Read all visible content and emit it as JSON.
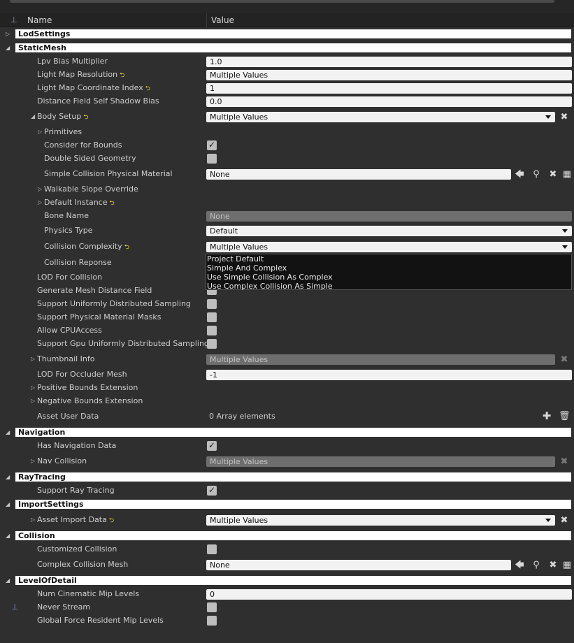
{
  "header": {
    "name_col": "Name",
    "value_col": "Value"
  },
  "categories": {
    "lod_settings": "LodSettings",
    "static_mesh": "StaticMesh",
    "navigation": "Navigation",
    "ray_tracing": "RayTracing",
    "import_settings": "ImportSettings",
    "collision": "Collision",
    "level_of_detail": "LevelOfDetail"
  },
  "static_mesh": {
    "lpv_bias_multiplier": {
      "label": "Lpv Bias Multiplier",
      "value": "1.0"
    },
    "light_map_resolution": {
      "label": "Light Map Resolution",
      "value": "Multiple Values"
    },
    "light_map_coordinate_index": {
      "label": "Light Map Coordinate Index",
      "value": "1"
    },
    "distance_field_self_shadow_bias": {
      "label": "Distance Field Self Shadow Bias",
      "value": "0.0"
    },
    "body_setup": {
      "label": "Body Setup",
      "value": "Multiple Values"
    },
    "primitives": {
      "label": "Primitives"
    },
    "consider_for_bounds": {
      "label": "Consider for Bounds",
      "checked": true
    },
    "double_sided_geometry": {
      "label": "Double Sided Geometry",
      "checked": false
    },
    "simple_collision_physical_material": {
      "label": "Simple Collision Physical Material",
      "value": "None"
    },
    "walkable_slope_override": {
      "label": "Walkable Slope Override"
    },
    "default_instance": {
      "label": "Default Instance"
    },
    "bone_name": {
      "label": "Bone Name",
      "value": "None"
    },
    "physics_type": {
      "label": "Physics Type",
      "value": "Default"
    },
    "collision_complexity": {
      "label": "Collision Complexity",
      "value": "Multiple Values"
    },
    "collision_reponse": {
      "label": "Collision Reponse"
    },
    "lod_for_collision": {
      "label": "LOD For Collision"
    },
    "generate_mesh_distance_field": {
      "label": "Generate Mesh Distance Field"
    },
    "support_uniformly_distributed_sampling": {
      "label": "Support Uniformly Distributed Sampling",
      "checked": false
    },
    "support_physical_material_masks": {
      "label": "Support Physical Material Masks",
      "checked": false
    },
    "allow_cpu_access": {
      "label": "Allow CPUAccess",
      "checked": false
    },
    "support_gpu_uniformly_distributed_sampling": {
      "label": "Support Gpu Uniformly Distributed Sampling",
      "checked": false
    },
    "thumbnail_info": {
      "label": "Thumbnail Info",
      "value": "Multiple Values"
    },
    "lod_for_occluder_mesh": {
      "label": "LOD For Occluder Mesh",
      "value": "-1"
    },
    "positive_bounds_extension": {
      "label": "Positive Bounds Extension"
    },
    "negative_bounds_extension": {
      "label": "Negative Bounds Extension"
    },
    "asset_user_data": {
      "label": "Asset User Data",
      "value": "0 Array elements"
    }
  },
  "collision_complexity_options": [
    "Project Default",
    "Simple And Complex",
    "Use Simple Collision As Complex",
    "Use Complex Collision As Simple"
  ],
  "navigation": {
    "has_navigation_data": {
      "label": "Has Navigation Data",
      "checked": true
    },
    "nav_collision": {
      "label": "Nav Collision",
      "value": "Multiple Values"
    }
  },
  "ray_tracing": {
    "support_ray_tracing": {
      "label": "Support Ray Tracing",
      "checked": true
    }
  },
  "import_settings": {
    "asset_import_data": {
      "label": "Asset Import Data",
      "value": "Multiple Values"
    }
  },
  "collision": {
    "customized_collision": {
      "label": "Customized Collision",
      "checked": false
    },
    "complex_collision_mesh": {
      "label": "Complex Collision Mesh",
      "value": "None"
    }
  },
  "level_of_detail": {
    "num_cinematic_mip_levels": {
      "label": "Num Cinematic Mip Levels",
      "value": "0"
    },
    "never_stream": {
      "label": "Never Stream",
      "checked": false
    },
    "global_force_resident_mip_levels": {
      "label": "Global Force Resident Mip Levels",
      "checked": false
    }
  },
  "icons": {
    "reset": "reset-arrow-icon",
    "pin": "pin-icon",
    "browse": "arrow-left-icon",
    "find": "magnifier-icon",
    "clear": "x-icon",
    "grid": "grid-icon",
    "add": "plus-icon",
    "delete": "trash-icon"
  },
  "colors": {
    "background": "#2f2f2f",
    "category_bg": "#ffffff",
    "reset_icon": "#f0e040"
  }
}
